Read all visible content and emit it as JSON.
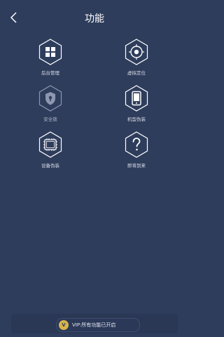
{
  "header": {
    "title": "功能"
  },
  "features": [
    {
      "label": "后台管理",
      "icon": "grid-icon"
    },
    {
      "label": "虚拟定位",
      "icon": "location-target-icon"
    },
    {
      "label": "安全锁",
      "icon": "shield-lock-icon"
    },
    {
      "label": "机型伪装",
      "icon": "phone-icon"
    },
    {
      "label": "设备伪装",
      "icon": "cpu-icon"
    },
    {
      "label": "即将到来",
      "icon": "question-icon"
    }
  ],
  "footer": {
    "vip_text": "VIP:所有功能已开启",
    "vip_icon_text": "V"
  },
  "colors": {
    "background": "#2f3d5c",
    "accent_gold": "#d7b44a"
  }
}
